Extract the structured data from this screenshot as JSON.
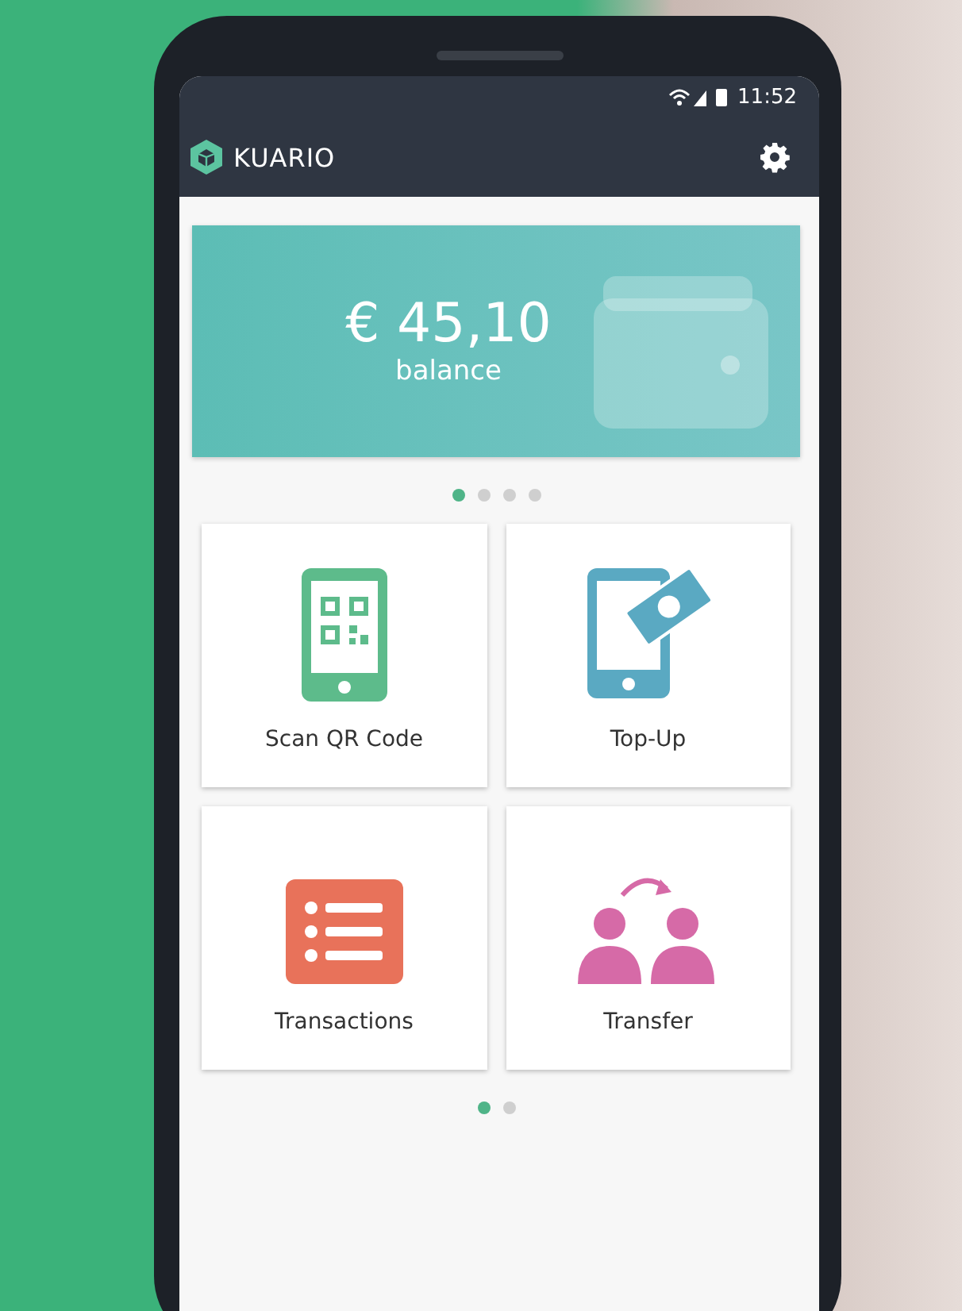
{
  "status_bar": {
    "time": "11:52"
  },
  "app_bar": {
    "logo_text": "KUARIO"
  },
  "balance_card": {
    "amount": "€ 45,10",
    "label": "balance"
  },
  "card_pager": [
    {
      "selected": true
    },
    {
      "selected": false
    },
    {
      "selected": false
    },
    {
      "selected": false
    }
  ],
  "tiles": [
    {
      "kind": "qr",
      "label": "Scan QR Code"
    },
    {
      "kind": "topup",
      "label": "Top-Up"
    },
    {
      "kind": "transactions",
      "label": "Transactions"
    },
    {
      "kind": "transfer",
      "label": "Transfer"
    }
  ],
  "tile_pager": [
    {
      "selected": true
    },
    {
      "selected": false
    }
  ]
}
